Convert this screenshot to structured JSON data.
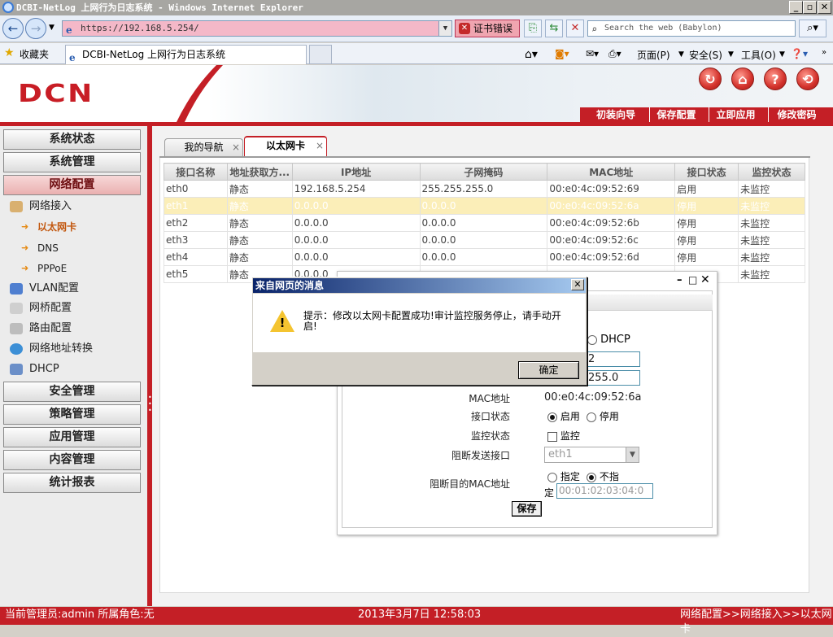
{
  "browser": {
    "title": "DCBI-NetLog 上网行为日志系统 - Windows Internet Explorer",
    "address": "https://192.168.5.254/",
    "cert_error": "证书错误",
    "search_placeholder": "Search the web (Babylon)",
    "favorites_label": "收藏夹",
    "tab_title": "DCBI-NetLog 上网行为日志系统",
    "commands": {
      "page": "页面(P)",
      "safety": "安全(S)",
      "tools": "工具(O)"
    }
  },
  "header": {
    "logo": "DCN",
    "links": [
      "初装向导",
      "保存配置",
      "立即应用",
      "修改密码"
    ],
    "accent": "#c41f26"
  },
  "sidebar": {
    "sections_top": [
      "系统状态",
      "系统管理",
      "网络配置"
    ],
    "network": {
      "group": "网络接入",
      "subitems": [
        "以太网卡",
        "DNS",
        "PPPoE"
      ],
      "items": [
        "VLAN配置",
        "网桥配置",
        "路由配置",
        "网络地址转换",
        "DHCP"
      ]
    },
    "sections_bottom": [
      "安全管理",
      "策略管理",
      "应用管理",
      "内容管理",
      "统计报表"
    ]
  },
  "content": {
    "tabs": [
      "我的导航",
      "以太网卡"
    ],
    "columns": [
      "接口名称",
      "地址获取方...",
      "IP地址",
      "子网掩码",
      "MAC地址",
      "接口状态",
      "监控状态"
    ],
    "rows": [
      [
        "eth0",
        "静态",
        "192.168.5.254",
        "255.255.255.0",
        "00:e0:4c:09:52:69",
        "启用",
        "未监控"
      ],
      [
        "eth1",
        "静态",
        "0.0.0.0",
        "0.0.0.0",
        "00:e0:4c:09:52:6a",
        "停用",
        "未监控"
      ],
      [
        "eth2",
        "静态",
        "0.0.0.0",
        "0.0.0.0",
        "00:e0:4c:09:52:6b",
        "停用",
        "未监控"
      ],
      [
        "eth3",
        "静态",
        "0.0.0.0",
        "0.0.0.0",
        "00:e0:4c:09:52:6c",
        "停用",
        "未监控"
      ],
      [
        "eth4",
        "静态",
        "0.0.0.0",
        "0.0.0.0",
        "00:e0:4c:09:52:6d",
        "停用",
        "未监控"
      ],
      [
        "eth5",
        "静态",
        "0.0.0.0",
        "",
        "",
        "",
        "未监控"
      ]
    ]
  },
  "form": {
    "dhcp_label": "DHCP",
    "ip_partial": "2",
    "mask_partial": "255.0",
    "mac_label": "MAC地址",
    "mac_value": "00:e0:4c:09:52:6a",
    "if_status_label": "接口状态",
    "enable": "启用",
    "disable": "停用",
    "monitor_label": "监控状态",
    "monitor_option": "监控",
    "block_if_label": "阻断发送接口",
    "block_if_value": "eth1",
    "block_mac_label": "阻断目的MAC地址",
    "specify": "指定",
    "not_specify_1": "不指",
    "not_specify_2": "定",
    "mac_placeholder": "00:01:02:03:04:0",
    "save": "保存"
  },
  "alert": {
    "title": "来自网页的消息",
    "message": "提示：修改以太网卡配置成功!审计监控服务停止，请手动开启!",
    "ok": "确定"
  },
  "status": {
    "admin": "当前管理员:admin  所属角色:无",
    "datetime": "2013年3月7日 12:58:03",
    "breadcrumb": "网络配置>>网络接入>>以太网卡"
  }
}
